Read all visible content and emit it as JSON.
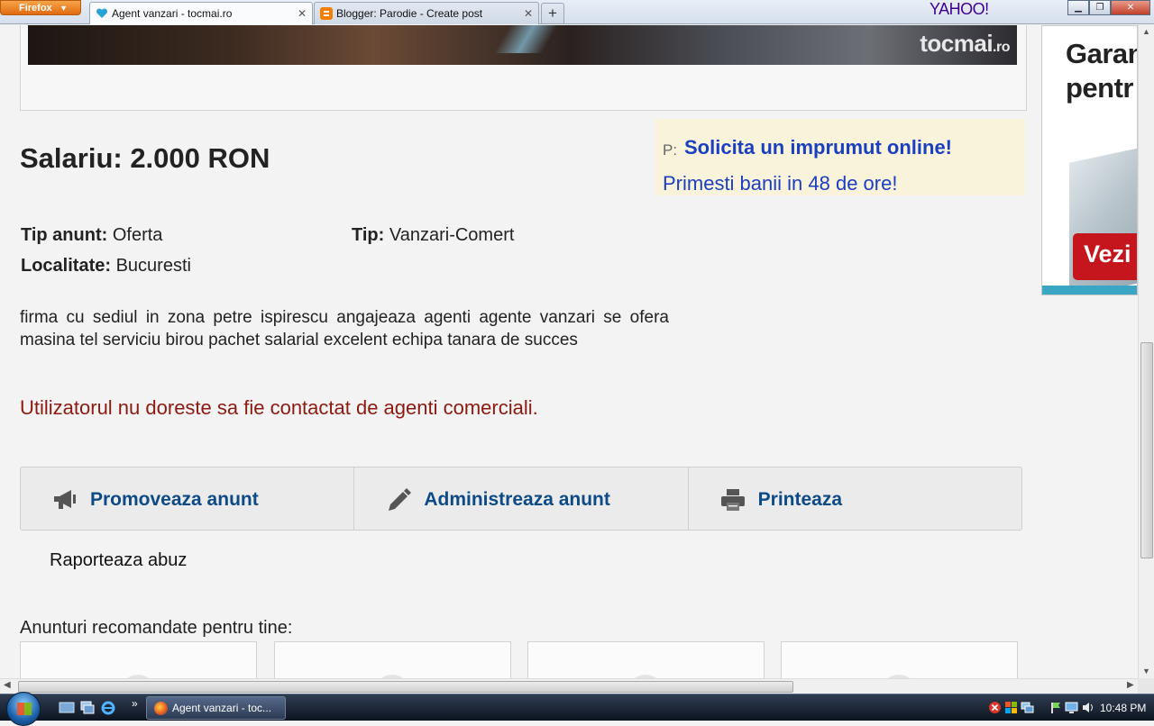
{
  "browser": {
    "menu_button": "Firefox",
    "tabs": [
      {
        "title": "Agent vanzari - tocmai.ro",
        "active": true
      },
      {
        "title": "Blogger: Parodie - Create post",
        "active": false
      }
    ],
    "new_tab": "+",
    "search_brand": "YAHOO!"
  },
  "hero": {
    "logo_main": "tocmai",
    "logo_suffix": ".ro"
  },
  "job": {
    "salary": "Salariu: 2.000 RON",
    "fields": {
      "tip_anunt_label": "Tip anunt:",
      "tip_anunt_value": "Oferta",
      "tip_label": "Tip:",
      "tip_value": "Vanzari-Comert",
      "localitate_label": "Localitate:",
      "localitate_value": "Bucuresti"
    },
    "description": "firma cu sediul in zona petre ispirescu angajeaza agenti agente vanzari se ofera masina tel serviciu birou pachet salarial excelent echipa tanara de succes",
    "notice": "Utilizatorul nu doreste sa fie contactat de agenti comerciali."
  },
  "ad": {
    "prefix": "P:",
    "title": "Solicita un imprumut online!",
    "text": "Primesti banii in 48 de ore!"
  },
  "side_ad": {
    "line1": "Garan",
    "line2": "pentr",
    "cta": "Vezi"
  },
  "actions": [
    {
      "label": "Promoveaza anunt",
      "icon": "megaphone-icon"
    },
    {
      "label": "Administreaza anunt",
      "icon": "pencil-icon"
    },
    {
      "label": "Printeaza",
      "icon": "printer-icon"
    }
  ],
  "report_link": "Raporteaza abuz",
  "recommended_heading": "Anunturi recomandate pentru tine:",
  "taskbar": {
    "task": "Agent vanzari - toc...",
    "clock": "10:48 PM"
  },
  "colors": {
    "link_blue": "#0e4a85",
    "ad_blue": "#1a3fbf",
    "notice_red": "#8b1a10",
    "ad_background": "#faf3dc"
  }
}
